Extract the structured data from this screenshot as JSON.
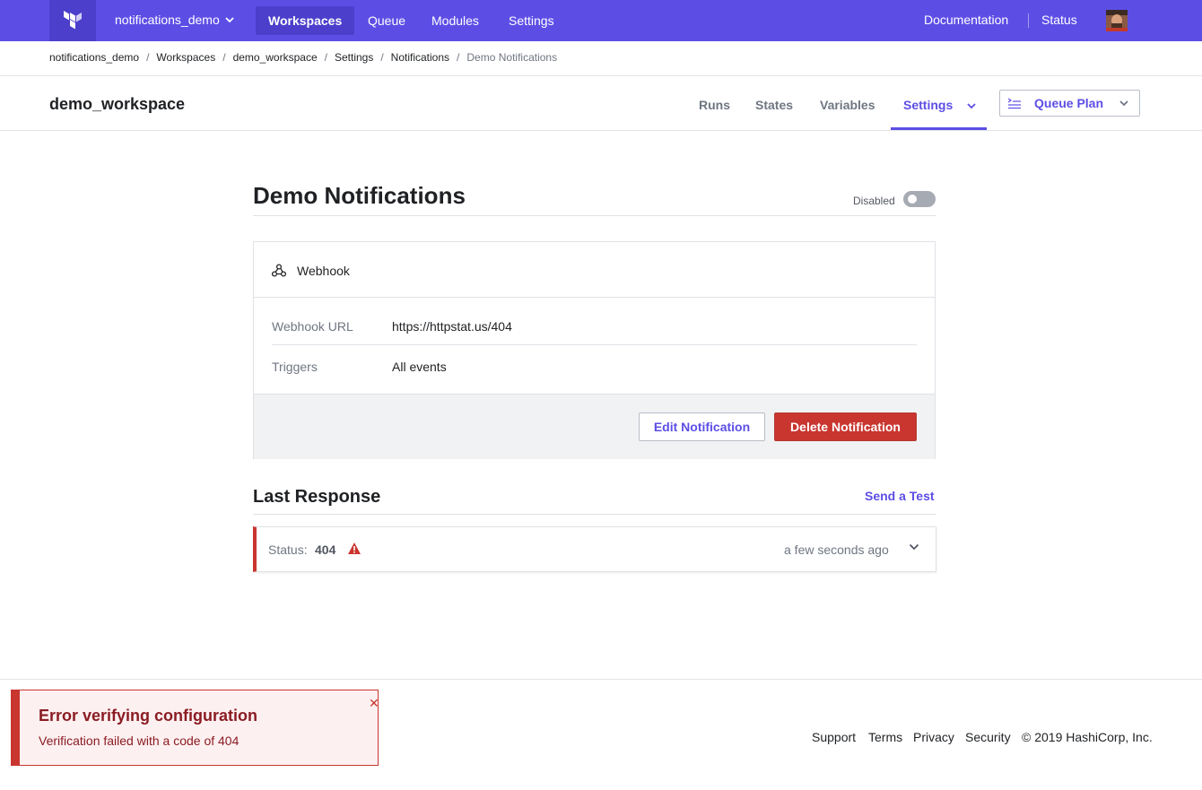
{
  "topnav": {
    "org": "notifications_demo",
    "items": [
      "Workspaces",
      "Queue",
      "Modules",
      "Settings"
    ],
    "active": "Workspaces",
    "right": [
      "Documentation",
      "Status"
    ]
  },
  "breadcrumbs": [
    "notifications_demo",
    "Workspaces",
    "demo_workspace",
    "Settings",
    "Notifications",
    "Demo Notifications"
  ],
  "workspace": {
    "name": "demo_workspace",
    "tabs": [
      "Runs",
      "States",
      "Variables",
      "Settings"
    ],
    "active_tab": "Settings",
    "queue_plan_label": "Queue Plan"
  },
  "notification": {
    "title": "Demo Notifications",
    "toggle_label": "Disabled",
    "enabled": false,
    "type": "Webhook",
    "url_label": "Webhook URL",
    "url": "https://httpstat.us/404",
    "triggers_label": "Triggers",
    "triggers": "All events",
    "edit_label": "Edit Notification",
    "delete_label": "Delete Notification"
  },
  "last_response": {
    "title": "Last Response",
    "send_test_label": "Send a Test",
    "status_label": "Status:",
    "status_code": "404",
    "time": "a few seconds ago"
  },
  "footer": {
    "links": [
      "Support",
      "Terms",
      "Privacy",
      "Security"
    ],
    "copyright": "© 2019 HashiCorp, Inc."
  },
  "toast": {
    "title": "Error verifying configuration",
    "message": "Verification failed with a code of 404"
  },
  "colors": {
    "brand": "#5c4ee5",
    "brand_dark": "#4b3fcb",
    "danger": "#c9352f"
  }
}
